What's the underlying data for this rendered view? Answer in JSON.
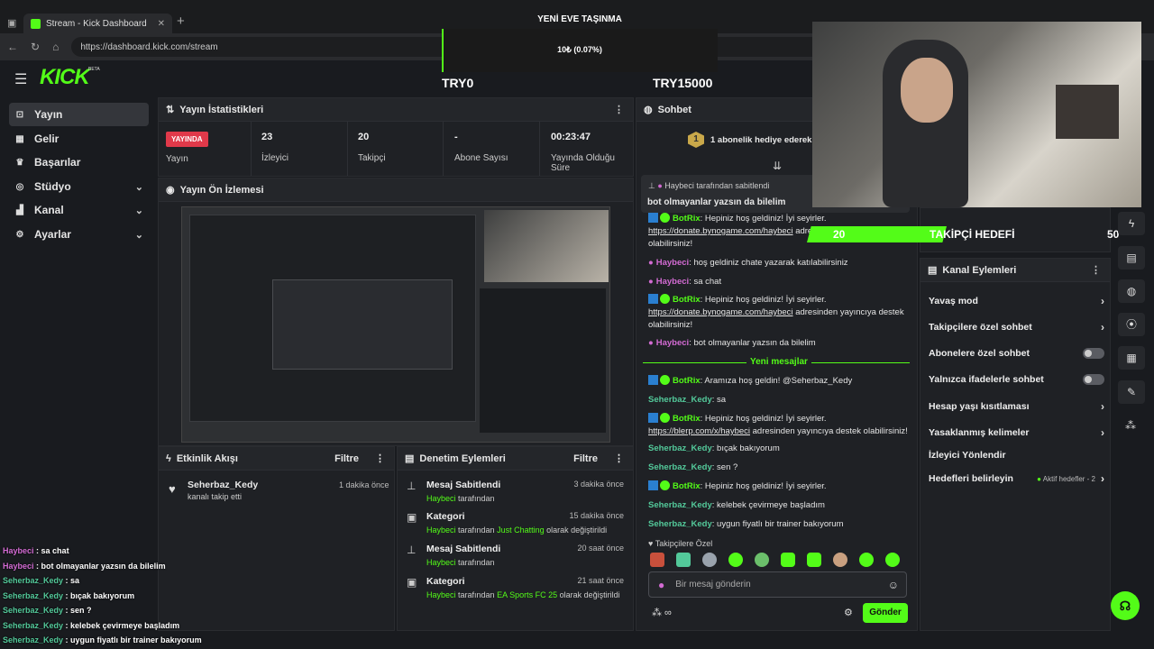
{
  "browser": {
    "tab_title": "Stream - Kick Dashboard",
    "url": "https://dashboard.kick.com/stream"
  },
  "goal": {
    "title": "YENİ EVE TAŞINMA",
    "progress_text": "10₺ (0.07%)",
    "min": "TRY0",
    "max": "TRY15000",
    "progress": 0.0007
  },
  "brand": {
    "logo": "KICK",
    "beta": "BETA"
  },
  "sidebar": {
    "items": [
      {
        "label": "Yayın",
        "icon": "broadcast-icon"
      },
      {
        "label": "Gelir",
        "icon": "revenue-icon"
      },
      {
        "label": "Başarılar",
        "icon": "trophy-icon"
      },
      {
        "label": "Stüdyo",
        "icon": "studio-icon"
      },
      {
        "label": "Kanal",
        "icon": "channel-icon"
      },
      {
        "label": "Ayarlar",
        "icon": "settings-icon"
      }
    ]
  },
  "stats": {
    "title": "Yayın İstatistikleri",
    "live": "YAYINDA",
    "live_label": "Yayın",
    "viewers": "23",
    "viewers_label": "İzleyici",
    "followers": "20",
    "followers_label": "Takipçi",
    "subs": "-",
    "subs_label": "Abone Sayısı",
    "duration": "00:23:47",
    "duration_label": "Yayında Olduğu Süre"
  },
  "preview": {
    "title": "Yayın Ön İzlemesi"
  },
  "activity": {
    "title": "Etkinlik Akışı",
    "filter": "Filtre",
    "items": [
      {
        "user": "Seherbaz_Kedy",
        "text": "kanalı takip etti",
        "time": "1 dakika önce"
      }
    ]
  },
  "modactions": {
    "title": "Denetim Eylemleri",
    "filter": "Filtre",
    "items": [
      {
        "title": "Mesaj Sabitlendi",
        "user": "Haybeci",
        "mid": "tarafından",
        "time": "3 dakika önce"
      },
      {
        "title": "Kategori",
        "user": "Haybeci",
        "mid": "tarafından",
        "cat": "Just Chatting",
        "tail": "olarak değiştirildi",
        "time": "15 dakika önce"
      },
      {
        "title": "Mesaj Sabitlendi",
        "user": "Haybeci",
        "mid": "tarafından",
        "time": "20 saat önce"
      },
      {
        "title": "Kategori",
        "user": "Haybeci",
        "mid": "tarafından",
        "cat": "EA Sports FC 25",
        "tail": "olarak değiştirildi",
        "time": "21 saat önce"
      }
    ]
  },
  "chat": {
    "title": "Sohbet",
    "gift_text": "1 abonelik hediye ederek 1.",
    "pinned_by": "Haybeci tarafından sabitlendi",
    "pinned_msg": "bot olmayanlar yazsın da bilelim",
    "new_messages": "Yeni mesajlar",
    "followers_only": "Takipçilere Özel",
    "input_placeholder": "Bir mesaj gönderin",
    "send": "Gönder",
    "messages": [
      {
        "user": "BotRix",
        "text": "Hepiniz hoş geldiniz! İyi seyirler.",
        "link": "https://donate.bynogame.com/haybeci",
        "tail": "adresinden yayıncıya destek olabilirsiniz!"
      },
      {
        "user": "Haybeci",
        "text": "hoş geldiniz chate yazarak katılabilirsiniz"
      },
      {
        "user": "Haybeci",
        "text": "sa chat"
      },
      {
        "user": "BotRix",
        "text": "Hepiniz hoş geldiniz! İyi seyirler.",
        "link": "https://donate.bynogame.com/haybeci",
        "tail": "adresinden yayıncıya destek olabilirsiniz!"
      },
      {
        "user": "Haybeci",
        "text": "bot olmayanlar yazsın da bilelim"
      },
      {
        "user": "BotRix",
        "text": "Aramıza hoş geldin! @Seherbaz_Kedy"
      },
      {
        "user": "Seherbaz_Kedy",
        "text": "sa"
      },
      {
        "user": "BotRix",
        "text": "Hepiniz hoş geldiniz! İyi seyirler.",
        "link": "https://blerp.com/x/haybeci",
        "tail": "adresinden yayıncıya destek olabilirsiniz!"
      },
      {
        "user": "Seherbaz_Kedy",
        "text": "bıçak bakıyorum"
      },
      {
        "user": "Seherbaz_Kedy",
        "text": "sen ?"
      },
      {
        "user": "BotRix",
        "text": "Hepiniz hoş geldiniz! İyi seyirler."
      },
      {
        "user": "Seherbaz_Kedy",
        "text": "kelebek çevirmeye başladım"
      },
      {
        "user": "Seherbaz_Kedy",
        "text": "uygun fiyatlı bir trainer bakıyorum"
      }
    ]
  },
  "follower_goal": {
    "current": "20",
    "label": "TAKİPÇİ HEDEFİ",
    "target": "50",
    "progress": 0.4
  },
  "channel_actions": {
    "title": "Kanal Eylemleri",
    "items": [
      {
        "label": "Yavaş mod",
        "type": "chevron"
      },
      {
        "label": "Takipçilere özel sohbet",
        "type": "chevron"
      },
      {
        "label": "Abonelere özel sohbet",
        "type": "toggle"
      },
      {
        "label": "Yalnızca ifadelerle sohbet",
        "type": "toggle"
      },
      {
        "label": "Hesap yaşı kısıtlaması",
        "type": "chevron"
      },
      {
        "label": "Yasaklanmış kelimeler",
        "type": "chevron"
      },
      {
        "label": "İzleyici Yönlendir",
        "type": "none"
      },
      {
        "label": "Hedefleri belirleyin",
        "type": "chevron",
        "badge": "Aktif hedefler - 2"
      }
    ]
  },
  "overlay_chat": [
    {
      "user": "Haybeci",
      "text": ": sa chat"
    },
    {
      "user": "Haybeci",
      "text": ": bot olmayanlar yazsın da bilelim"
    },
    {
      "user": "Seherbaz_Kedy",
      "text": ": sa"
    },
    {
      "user": "Seherbaz_Kedy",
      "text": ": bıçak bakıyorum"
    },
    {
      "user": "Seherbaz_Kedy",
      "text": ": sen ?"
    },
    {
      "user": "Seherbaz_Kedy",
      "text": ": kelebek çevirmeye başladım"
    },
    {
      "user": "Seherbaz_Kedy",
      "text": ": uygun fiyatlı bir trainer bakıyorum"
    }
  ],
  "colors": {
    "accent": "#53fc18",
    "live": "#e0394a",
    "haybeci": "#d36bd3",
    "seherbaz": "#53c99a"
  }
}
